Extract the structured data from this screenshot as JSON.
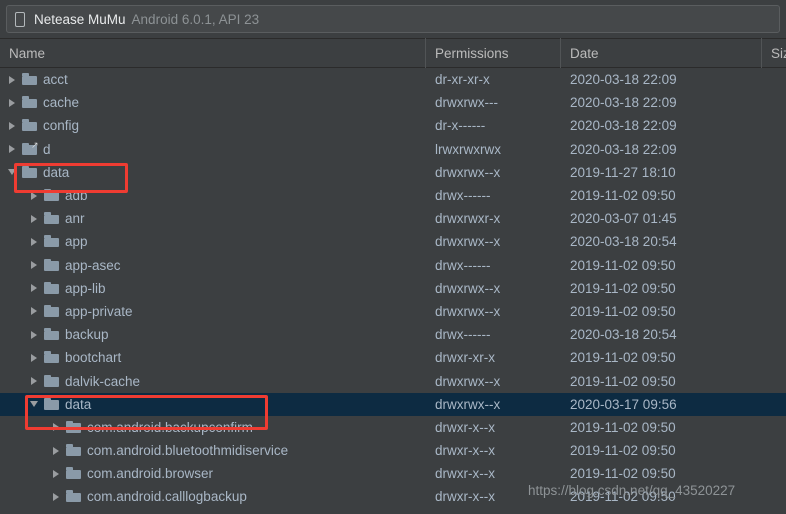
{
  "device_bar": {
    "icon": "device-phone-icon",
    "device_name": "Netease MuMu",
    "android_version": "Android 6.0.1, API 23"
  },
  "columns": [
    {
      "key": "name",
      "label": "Name"
    },
    {
      "key": "permissions",
      "label": "Permissions"
    },
    {
      "key": "date",
      "label": "Date"
    },
    {
      "key": "size",
      "label": "Siz"
    }
  ],
  "colors": {
    "background": "#3c3f41",
    "selection": "#0d2b42",
    "text": "#a9b7c6",
    "header_text": "#bbbbbb",
    "folder_icon": "#8a9aa8",
    "annotation": "#ef3c32"
  },
  "annotations": [
    {
      "name": "red-box-data-top",
      "target": "data"
    },
    {
      "name": "red-box-data-nested",
      "target": "data/data"
    }
  ],
  "watermark": "https://blog.csdn.net/qq_43520227",
  "rows": [
    {
      "name": "acct",
      "depth": 0,
      "twisty": "collapsed",
      "icon": "folder",
      "permissions": "dr-xr-xr-x",
      "date": "2020-03-18 22:09",
      "size": "",
      "selected": false
    },
    {
      "name": "cache",
      "depth": 0,
      "twisty": "collapsed",
      "icon": "folder",
      "permissions": "drwxrwx---",
      "date": "2020-03-18 22:09",
      "size": "",
      "selected": false
    },
    {
      "name": "config",
      "depth": 0,
      "twisty": "collapsed",
      "icon": "folder",
      "permissions": "dr-x------",
      "date": "2020-03-18 22:09",
      "size": "",
      "selected": false
    },
    {
      "name": "d",
      "depth": 0,
      "twisty": "collapsed",
      "icon": "folder-link",
      "permissions": "lrwxrwxrwx",
      "date": "2020-03-18 22:09",
      "size": "",
      "selected": false
    },
    {
      "name": "data",
      "depth": 0,
      "twisty": "expanded",
      "icon": "folder",
      "permissions": "drwxrwx--x",
      "date": "2019-11-27 18:10",
      "size": "",
      "selected": false
    },
    {
      "name": "adb",
      "depth": 1,
      "twisty": "collapsed",
      "icon": "folder",
      "permissions": "drwx------",
      "date": "2019-11-02 09:50",
      "size": "",
      "selected": false
    },
    {
      "name": "anr",
      "depth": 1,
      "twisty": "collapsed",
      "icon": "folder",
      "permissions": "drwxrwxr-x",
      "date": "2020-03-07 01:45",
      "size": "",
      "selected": false
    },
    {
      "name": "app",
      "depth": 1,
      "twisty": "collapsed",
      "icon": "folder",
      "permissions": "drwxrwx--x",
      "date": "2020-03-18 20:54",
      "size": "",
      "selected": false
    },
    {
      "name": "app-asec",
      "depth": 1,
      "twisty": "collapsed",
      "icon": "folder",
      "permissions": "drwx------",
      "date": "2019-11-02 09:50",
      "size": "",
      "selected": false
    },
    {
      "name": "app-lib",
      "depth": 1,
      "twisty": "collapsed",
      "icon": "folder",
      "permissions": "drwxrwx--x",
      "date": "2019-11-02 09:50",
      "size": "",
      "selected": false
    },
    {
      "name": "app-private",
      "depth": 1,
      "twisty": "collapsed",
      "icon": "folder",
      "permissions": "drwxrwx--x",
      "date": "2019-11-02 09:50",
      "size": "",
      "selected": false
    },
    {
      "name": "backup",
      "depth": 1,
      "twisty": "collapsed",
      "icon": "folder",
      "permissions": "drwx------",
      "date": "2020-03-18 20:54",
      "size": "",
      "selected": false
    },
    {
      "name": "bootchart",
      "depth": 1,
      "twisty": "collapsed",
      "icon": "folder",
      "permissions": "drwxr-xr-x",
      "date": "2019-11-02 09:50",
      "size": "",
      "selected": false
    },
    {
      "name": "dalvik-cache",
      "depth": 1,
      "twisty": "collapsed",
      "icon": "folder",
      "permissions": "drwxrwx--x",
      "date": "2019-11-02 09:50",
      "size": "",
      "selected": false
    },
    {
      "name": "data",
      "depth": 1,
      "twisty": "expanded",
      "icon": "folder",
      "permissions": "drwxrwx--x",
      "date": "2020-03-17 09:56",
      "size": "",
      "selected": true
    },
    {
      "name": "com.android.backupconfirm",
      "depth": 2,
      "twisty": "collapsed",
      "icon": "folder",
      "permissions": "drwxr-x--x",
      "date": "2019-11-02 09:50",
      "size": "",
      "selected": false
    },
    {
      "name": "com.android.bluetoothmidiservice",
      "depth": 2,
      "twisty": "collapsed",
      "icon": "folder",
      "permissions": "drwxr-x--x",
      "date": "2019-11-02 09:50",
      "size": "",
      "selected": false
    },
    {
      "name": "com.android.browser",
      "depth": 2,
      "twisty": "collapsed",
      "icon": "folder",
      "permissions": "drwxr-x--x",
      "date": "2019-11-02 09:50",
      "size": "",
      "selected": false
    },
    {
      "name": "com.android.calllogbackup",
      "depth": 2,
      "twisty": "collapsed",
      "icon": "folder",
      "permissions": "drwxr-x--x",
      "date": "2019-11-02 09:50",
      "size": "",
      "selected": false
    }
  ]
}
